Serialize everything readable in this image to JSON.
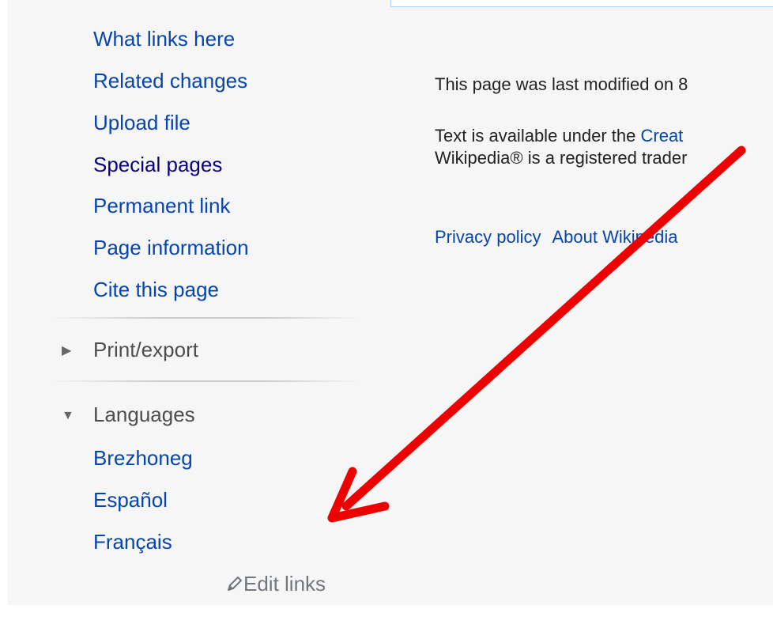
{
  "sidebar": {
    "tools": [
      {
        "label": "What links here"
      },
      {
        "label": "Related changes"
      },
      {
        "label": "Upload file"
      },
      {
        "label": "Special pages"
      },
      {
        "label": "Permanent link"
      },
      {
        "label": "Page information"
      },
      {
        "label": "Cite this page"
      }
    ],
    "print_export_heading": "Print/export",
    "languages_heading": "Languages",
    "languages": [
      {
        "label": "Brezhoneg"
      },
      {
        "label": "Español"
      },
      {
        "label": "Français"
      }
    ],
    "edit_links_label": "Edit links"
  },
  "footer": {
    "last_modified": "This page was last modified on 8",
    "license_prefix": "Text is available under the ",
    "license_link": "Creat",
    "trademark_prefix": "Wikipedia® is a registered tra",
    "trademark_tail": "der",
    "places": [
      {
        "label": "Privacy policy"
      },
      {
        "label": "About Wikipedia"
      }
    ]
  },
  "annotation": {
    "arrow_color": "#ee0000"
  },
  "icons": {
    "collapsed_triangle": "▶",
    "expanded_triangle": "▼",
    "pencil": "pencil-icon"
  }
}
